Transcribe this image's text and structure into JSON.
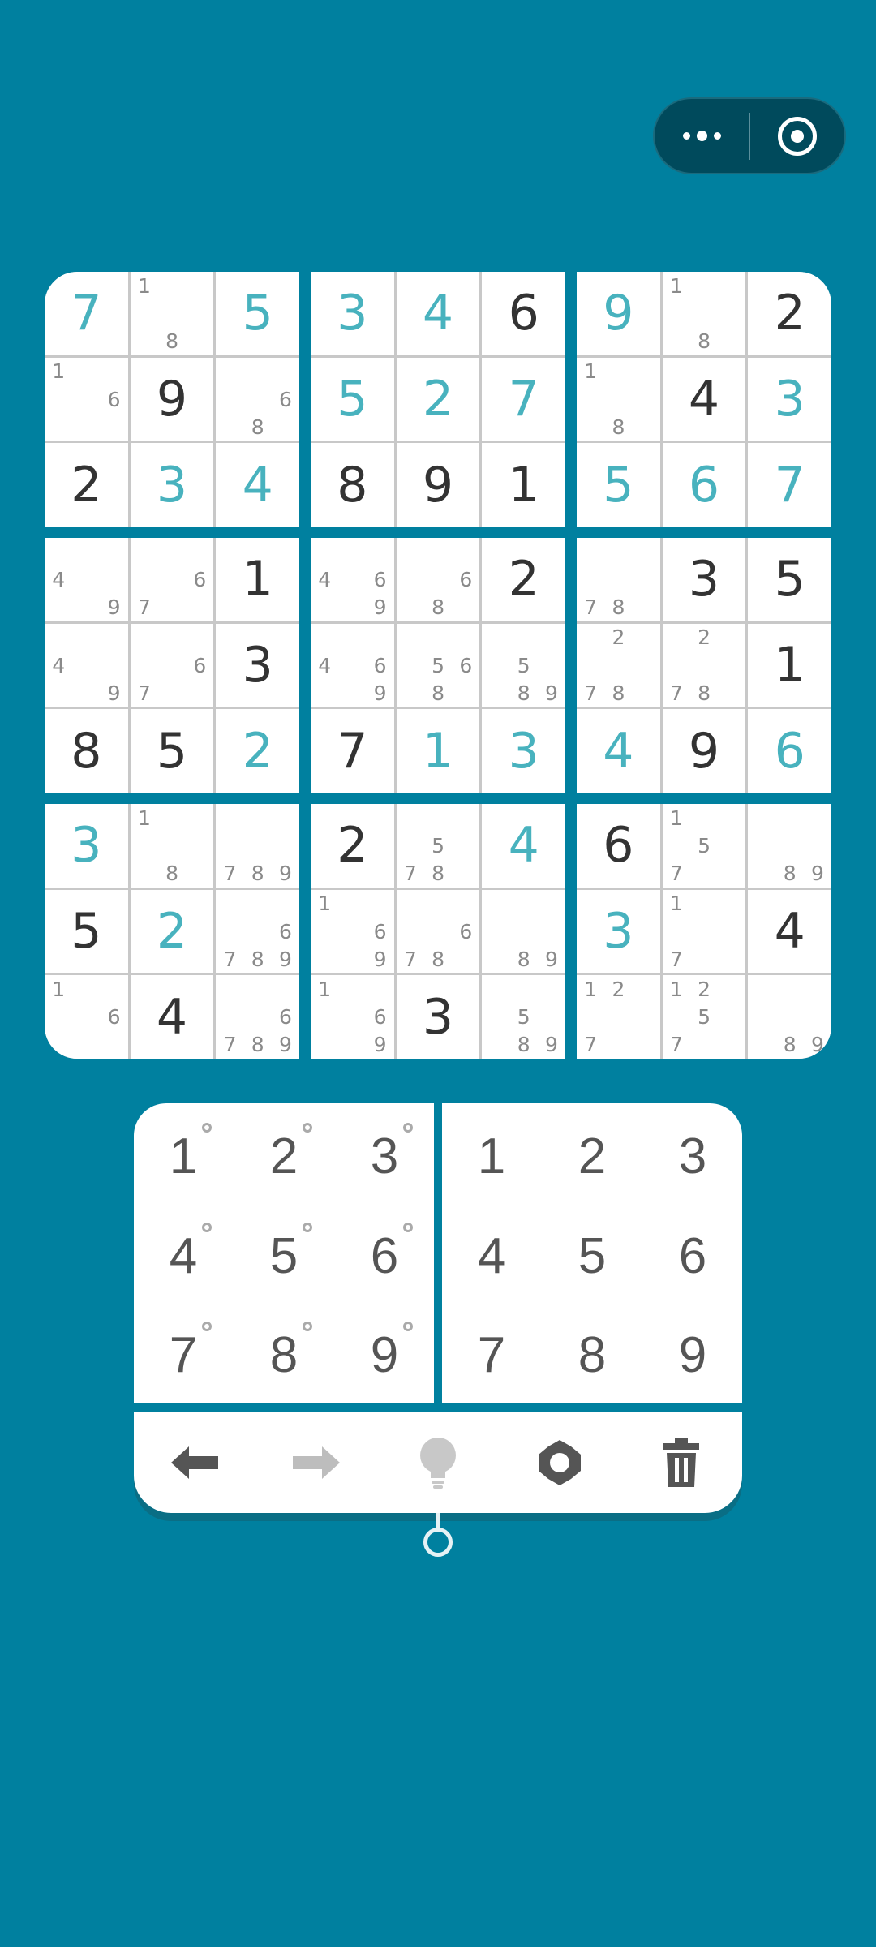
{
  "colors": {
    "background": "#00809f",
    "given_digit": "#333333",
    "filled_digit": "#48b2be",
    "note_digit": "#8a8a8a",
    "pad_digit": "#555555"
  },
  "top_bar": {
    "menu_icon": "more-dots-icon",
    "target_icon": "target-circle-icon"
  },
  "grid": [
    [
      {
        "v": "7",
        "t": "f"
      },
      {
        "n": "18"
      },
      {
        "v": "5",
        "t": "f"
      },
      {
        "v": "3",
        "t": "f"
      },
      {
        "v": "4",
        "t": "f"
      },
      {
        "v": "6",
        "t": "g"
      },
      {
        "v": "9",
        "t": "f"
      },
      {
        "n": "18"
      },
      {
        "v": "2",
        "t": "g"
      }
    ],
    [
      {
        "n": "16"
      },
      {
        "v": "9",
        "t": "g"
      },
      {
        "n": "68"
      },
      {
        "v": "5",
        "t": "f"
      },
      {
        "v": "2",
        "t": "f"
      },
      {
        "v": "7",
        "t": "f"
      },
      {
        "n": "18"
      },
      {
        "v": "4",
        "t": "g"
      },
      {
        "v": "3",
        "t": "f"
      }
    ],
    [
      {
        "v": "2",
        "t": "g"
      },
      {
        "v": "3",
        "t": "f"
      },
      {
        "v": "4",
        "t": "f"
      },
      {
        "v": "8",
        "t": "g"
      },
      {
        "v": "9",
        "t": "g"
      },
      {
        "v": "1",
        "t": "g"
      },
      {
        "v": "5",
        "t": "f"
      },
      {
        "v": "6",
        "t": "f"
      },
      {
        "v": "7",
        "t": "f"
      }
    ],
    [
      {
        "n": "49"
      },
      {
        "n": "67"
      },
      {
        "v": "1",
        "t": "g"
      },
      {
        "n": "469"
      },
      {
        "n": "68"
      },
      {
        "v": "2",
        "t": "g"
      },
      {
        "n": "78"
      },
      {
        "v": "3",
        "t": "g"
      },
      {
        "v": "5",
        "t": "g"
      }
    ],
    [
      {
        "n": "49"
      },
      {
        "n": "67"
      },
      {
        "v": "3",
        "t": "g"
      },
      {
        "n": "469"
      },
      {
        "n": "568"
      },
      {
        "n": "589"
      },
      {
        "n": "278"
      },
      {
        "n": "278"
      },
      {
        "v": "1",
        "t": "g"
      }
    ],
    [
      {
        "v": "8",
        "t": "g"
      },
      {
        "v": "5",
        "t": "g"
      },
      {
        "v": "2",
        "t": "f"
      },
      {
        "v": "7",
        "t": "g"
      },
      {
        "v": "1",
        "t": "f"
      },
      {
        "v": "3",
        "t": "f"
      },
      {
        "v": "4",
        "t": "f"
      },
      {
        "v": "9",
        "t": "g"
      },
      {
        "v": "6",
        "t": "f"
      }
    ],
    [
      {
        "v": "3",
        "t": "f"
      },
      {
        "n": "18"
      },
      {
        "n": "789"
      },
      {
        "v": "2",
        "t": "g"
      },
      {
        "n": "578"
      },
      {
        "v": "4",
        "t": "f"
      },
      {
        "v": "6",
        "t": "g"
      },
      {
        "n": "157"
      },
      {
        "n": "89"
      }
    ],
    [
      {
        "v": "5",
        "t": "g"
      },
      {
        "v": "2",
        "t": "f"
      },
      {
        "n": "6789"
      },
      {
        "n": "169"
      },
      {
        "n": "678"
      },
      {
        "n": "89"
      },
      {
        "v": "3",
        "t": "f"
      },
      {
        "n": "17"
      },
      {
        "v": "4",
        "t": "g"
      }
    ],
    [
      {
        "n": "16"
      },
      {
        "v": "4",
        "t": "g"
      },
      {
        "n": "6789"
      },
      {
        "n": "169"
      },
      {
        "v": "3",
        "t": "g"
      },
      {
        "n": "589"
      },
      {
        "n": "127"
      },
      {
        "n": "1257"
      },
      {
        "n": "89"
      }
    ]
  ],
  "notes_pad": {
    "keys": [
      "1",
      "2",
      "3",
      "4",
      "5",
      "6",
      "7",
      "8",
      "9"
    ]
  },
  "number_pad": {
    "keys": [
      "1",
      "2",
      "3",
      "4",
      "5",
      "6",
      "7",
      "8",
      "9"
    ]
  },
  "toolbar": {
    "undo_icon": "undo-arrow-icon",
    "redo_icon": "redo-arrow-icon",
    "hint_icon": "lightbulb-icon",
    "settings_icon": "gear-icon",
    "delete_icon": "trash-icon"
  }
}
